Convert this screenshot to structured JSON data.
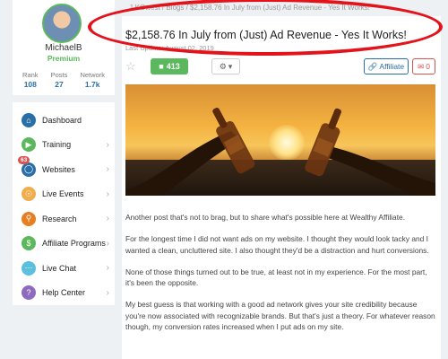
{
  "profile": {
    "username": "MichaelB",
    "membership": "Premium",
    "stats": [
      {
        "label": "Rank",
        "value": "108"
      },
      {
        "label": "Posts",
        "value": "27"
      },
      {
        "label": "Network",
        "value": "1.7k"
      }
    ]
  },
  "nav": {
    "items": [
      {
        "label": "Dashboard",
        "icon": "home-icon",
        "color": "#2a6ea6"
      },
      {
        "label": "Training",
        "icon": "play-icon",
        "color": "#5cb85c"
      },
      {
        "label": "Websites",
        "icon": "globe-icon",
        "color": "#2a6ea6",
        "badge": "63"
      },
      {
        "label": "Live Events",
        "icon": "broadcast-icon",
        "color": "#f0ad4e"
      },
      {
        "label": "Research",
        "icon": "research-icon",
        "color": "#e67e22"
      },
      {
        "label": "Affiliate Programs",
        "icon": "dollar-icon",
        "color": "#5cb85c"
      },
      {
        "label": "Live Chat",
        "icon": "chat-icon",
        "color": "#5bc0de"
      },
      {
        "label": "Help Center",
        "icon": "help-icon",
        "color": "#8e6bbf"
      }
    ]
  },
  "breadcrumb": "J-KOwest  /  Blogs  /  $2,158.76 In July from (Just) Ad Revenue - Yes It Works!",
  "post": {
    "title": "$2,158.76 In July from (Just) Ad Revenue - Yes It Works!",
    "last_update": "Last Update: August 02, 2019",
    "comment_count": "413",
    "affiliate_label": "Affiliate",
    "mail_count": "0"
  },
  "article": {
    "paragraphs": [
      "Another post that's not to brag, but to share what's possible here at Wealthy Affiliate.",
      "For the longest time I did not want ads on my website. I thought they would look tacky and I wanted a clean, uncluttered site. I also thought they'd be a distraction and hurt conversions.",
      "None of those things turned out to be true, at least not in my experience. For the most part, it's been the opposite.",
      "My best guess is that working with a good ad network gives your site credibility because you're now associated with recognizable brands. But that's just a theory. For whatever reason though, my conversion rates increased when I put ads on my site."
    ]
  },
  "colors": {
    "accent": "#5cb85c",
    "link": "#2a6ea6",
    "annotation": "#e3121b"
  }
}
